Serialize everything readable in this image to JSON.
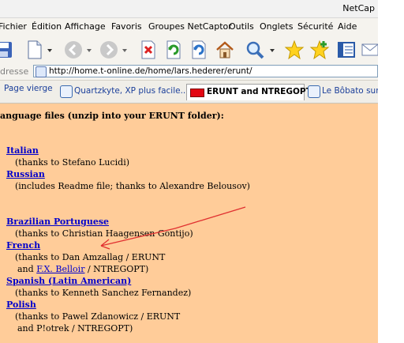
{
  "window": {
    "title": "NetCap"
  },
  "menu": [
    "Fichier",
    "Édition",
    "Affichage",
    "Favoris",
    "Groupes NetCaptor",
    "Outils",
    "Onglets",
    "Sécurité",
    "Aide"
  ],
  "toolbar": {
    "icons": [
      "save-icon",
      "new-document-icon",
      "back-icon",
      "forward-icon",
      "stop-icon",
      "refresh-icon",
      "refresh-all-icon",
      "home-icon",
      "search-icon",
      "favorites-icon",
      "add-favorite-icon",
      "view-icon",
      "mail-icon"
    ]
  },
  "address": {
    "label": "dresse",
    "url": "http://home.t-online.de/home/lars.hederer/erunt/"
  },
  "tabs": [
    {
      "label": "Page vierge",
      "active": false
    },
    {
      "label": "Quartzkyte, XP plus facile...",
      "active": false
    },
    {
      "label": "ERUNT and NTREGOPT",
      "active": true
    },
    {
      "label": "Le Bôbato sur",
      "active": false
    }
  ],
  "page": {
    "heading": "anguage files (unzip into your ERUNT folder):",
    "entries": [
      {
        "link": "Italian",
        "lines": [
          "(thanks to Stefano Lucidi)"
        ]
      },
      {
        "link": "Russian",
        "lines": [
          "(includes Readme file; thanks to Alexandre Belousov)"
        ]
      },
      {
        "link": "Brazilian Portuguese",
        "lines": [
          "(thanks to Christian Haagensen Gontijo)"
        ]
      },
      {
        "link": "French",
        "lines": [
          "(thanks to Dan Amzallag / ERUNT",
          "and ",
          "F.X. Belloir",
          " / NTREGOPT)"
        ]
      },
      {
        "link": "Spanish (Latin American)",
        "lines": [
          "(thanks to Kenneth Sanchez Fernandez)"
        ]
      },
      {
        "link": "Polish",
        "lines": [
          "(thanks to Pawel Zdanowicz / ERUNT",
          "and P!otrek / NTREGOPT)"
        ]
      }
    ]
  },
  "colors": {
    "page_bg": "#ffcc99",
    "link": "#0000cc",
    "arrow": "#e03030",
    "active_tab_flag": "#e30613"
  }
}
